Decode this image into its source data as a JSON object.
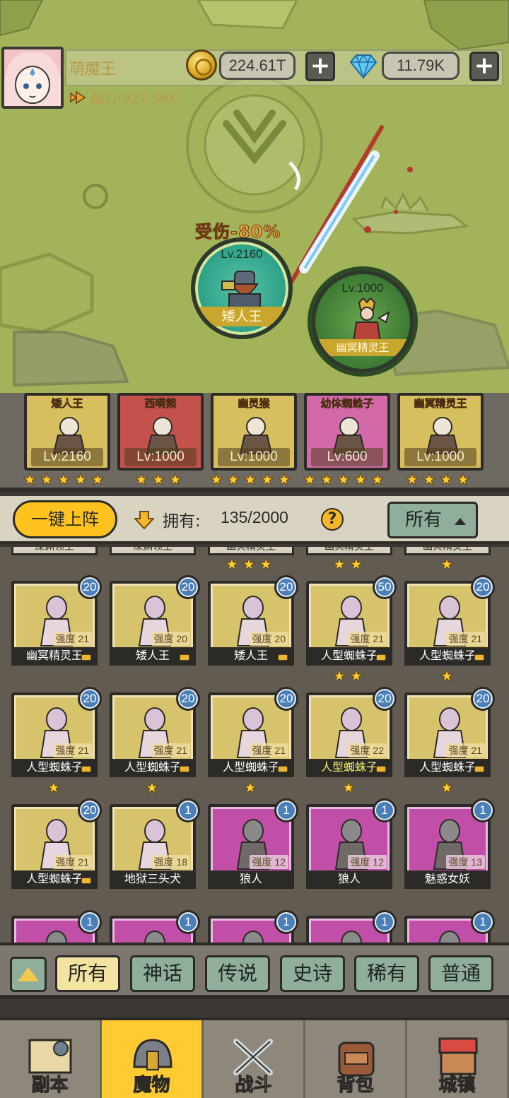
{
  "player": {
    "name": "萌魔王",
    "power_label": "战力:922.58K"
  },
  "currency": {
    "gold": "224.61T",
    "gems": "11.79K",
    "plus": "+"
  },
  "battle": {
    "damage_label": "受伤-80%",
    "unit_left": {
      "level": "Lv.2160",
      "name": "矮人王"
    },
    "unit_right": {
      "level": "Lv.1000",
      "name": "幽冥精灵王"
    }
  },
  "team": [
    {
      "name": "矮人王",
      "level": "Lv:2160",
      "stars": 5,
      "color": "gold"
    },
    {
      "name": "西嗬熊",
      "level": "Lv:1000",
      "stars": 3,
      "color": "red"
    },
    {
      "name": "幽灵猴",
      "level": "Lv:1000",
      "stars": 5,
      "color": "gold"
    },
    {
      "name": "幼体蜘蛛子",
      "level": "Lv:600",
      "stars": 5,
      "color": "pink"
    },
    {
      "name": "幽冥精灵王",
      "level": "Lv:1000",
      "stars": 4,
      "color": "gold"
    }
  ],
  "controls": {
    "deploy_button": "一键上阵",
    "owned_label": "拥有:",
    "owned_value": "135/2000",
    "help": "?",
    "filter": "所有"
  },
  "partial_row": {
    "names": [
      "深渊领主",
      "深渊领主",
      "幽冥精灵王",
      "幽冥精灵王",
      "幽冥精灵王"
    ],
    "stars": [
      0,
      0,
      3,
      2,
      1
    ]
  },
  "monsters": [
    {
      "name": "幽冥精灵王",
      "power": "强度 21",
      "count": "20",
      "color": "gold",
      "locked": true,
      "stars": 0,
      "highlight": false
    },
    {
      "name": "矮人王",
      "power": "强度 20",
      "count": "20",
      "color": "gold",
      "locked": true,
      "stars": 0,
      "highlight": false
    },
    {
      "name": "矮人王",
      "power": "强度 20",
      "count": "20",
      "color": "gold",
      "locked": true,
      "stars": 0,
      "highlight": false
    },
    {
      "name": "人型蜘蛛子",
      "power": "强度 21",
      "count": "50",
      "color": "gold",
      "locked": true,
      "stars": 2,
      "highlight": false
    },
    {
      "name": "人型蜘蛛子",
      "power": "强度 21",
      "count": "20",
      "color": "gold",
      "locked": true,
      "stars": 1,
      "highlight": false
    },
    {
      "name": "人型蜘蛛子",
      "power": "强度 21",
      "count": "20",
      "color": "gold",
      "locked": true,
      "stars": 1,
      "highlight": false
    },
    {
      "name": "人型蜘蛛子",
      "power": "强度 21",
      "count": "20",
      "color": "gold",
      "locked": true,
      "stars": 1,
      "highlight": false
    },
    {
      "name": "人型蜘蛛子",
      "power": "强度 21",
      "count": "20",
      "color": "gold",
      "locked": true,
      "stars": 1,
      "highlight": false
    },
    {
      "name": "人型蜘蛛子",
      "power": "强度 22",
      "count": "20",
      "color": "gold",
      "locked": true,
      "stars": 1,
      "highlight": true
    },
    {
      "name": "人型蜘蛛子",
      "power": "强度 21",
      "count": "20",
      "color": "gold",
      "locked": true,
      "stars": 1,
      "highlight": false
    },
    {
      "name": "人型蜘蛛子",
      "power": "强度 21",
      "count": "20",
      "color": "gold",
      "locked": true,
      "stars": 0,
      "highlight": false
    },
    {
      "name": "地狱三头犬",
      "power": "强度 18",
      "count": "1",
      "color": "gold",
      "locked": false,
      "stars": 0,
      "highlight": false
    },
    {
      "name": "狼人",
      "power": "强度 12",
      "count": "1",
      "color": "purple",
      "locked": false,
      "stars": 0,
      "highlight": false
    },
    {
      "name": "狼人",
      "power": "强度 12",
      "count": "1",
      "color": "purple",
      "locked": false,
      "stars": 0,
      "highlight": false
    },
    {
      "name": "魅惑女妖",
      "power": "强度 13",
      "count": "1",
      "color": "purple",
      "locked": false,
      "stars": 0,
      "highlight": false
    },
    {
      "name": "",
      "power": "",
      "count": "1",
      "color": "purple",
      "locked": false,
      "stars": 0,
      "highlight": false
    },
    {
      "name": "",
      "power": "",
      "count": "1",
      "color": "purple",
      "locked": false,
      "stars": 0,
      "highlight": false
    },
    {
      "name": "",
      "power": "",
      "count": "1",
      "color": "purple",
      "locked": false,
      "stars": 0,
      "highlight": false
    },
    {
      "name": "",
      "power": "",
      "count": "1",
      "color": "purple",
      "locked": false,
      "stars": 0,
      "highlight": false
    },
    {
      "name": "",
      "power": "",
      "count": "1",
      "color": "purple",
      "locked": false,
      "stars": 0,
      "highlight": false
    }
  ],
  "rarity_tabs": [
    {
      "label": "所有",
      "active": true
    },
    {
      "label": "神话",
      "active": false
    },
    {
      "label": "传说",
      "active": false
    },
    {
      "label": "史诗",
      "active": false
    },
    {
      "label": "稀有",
      "active": false
    },
    {
      "label": "普通",
      "active": false
    }
  ],
  "nav": [
    {
      "label": "副本",
      "icon": "map-icon",
      "active": false
    },
    {
      "label": "魔物",
      "icon": "helmet-icon",
      "active": true
    },
    {
      "label": "战斗",
      "icon": "crossed-swords-icon",
      "active": false
    },
    {
      "label": "背包",
      "icon": "backpack-icon",
      "active": false
    },
    {
      "label": "城镇",
      "icon": "town-icon",
      "active": false
    }
  ],
  "colors": {
    "map": "#a3b35a",
    "gold_card": "#d6c36b",
    "purple_card": "#c14fa7",
    "accent_yellow": "#ffc21f",
    "count_badge": "#4a7fb7"
  }
}
